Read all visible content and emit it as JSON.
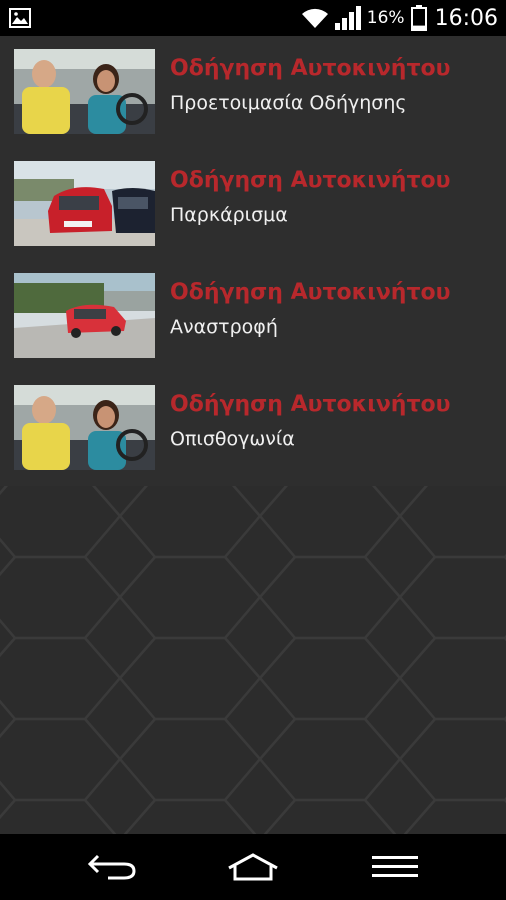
{
  "status_bar": {
    "battery_percent": "16%",
    "time": "16:06",
    "battery_level": 0.16,
    "icons": [
      "gallery-icon",
      "wifi-icon",
      "signal-icon",
      "battery-icon"
    ]
  },
  "videos": [
    {
      "title": "Οδήγηση Αυτοκινήτου",
      "subtitle": "Προετοιμασία Οδήγησης",
      "thumbnail": "instructor-and-driver"
    },
    {
      "title": "Οδήγηση Αυτοκινήτου",
      "subtitle": "Παρκάρισμα",
      "thumbnail": "parked-red-car"
    },
    {
      "title": "Οδήγηση Αυτοκινήτου",
      "subtitle": "Αναστροφή",
      "thumbnail": "red-car-on-road"
    },
    {
      "title": "Οδήγηση Αυτοκινήτου",
      "subtitle": "Οπισθογωνία",
      "thumbnail": "instructor-and-driver"
    }
  ],
  "colors": {
    "title": "#b8282c",
    "subtitle": "#f0f0f0",
    "background": "#2c2c2c"
  },
  "nav_bar": {
    "icons": [
      "back-icon",
      "home-icon",
      "menu-icon"
    ]
  }
}
